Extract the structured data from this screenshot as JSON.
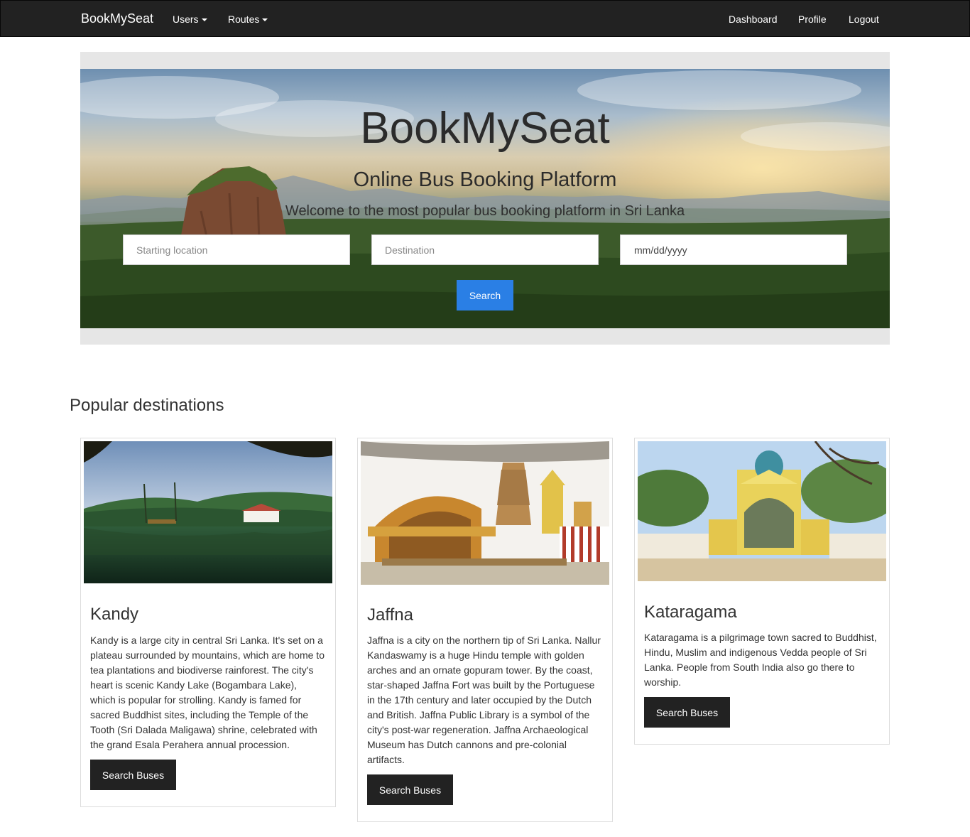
{
  "navbar": {
    "brand": "BookMySeat",
    "left_items": [
      {
        "label": "Users",
        "has_dropdown": true
      },
      {
        "label": "Routes",
        "has_dropdown": true
      }
    ],
    "right_items": [
      {
        "label": "Dashboard"
      },
      {
        "label": "Profile"
      },
      {
        "label": "Logout"
      }
    ]
  },
  "hero": {
    "title": "BookMySeat",
    "subtitle": "Online Bus Booking Platform",
    "lead": "Welcome to the most popular bus booking platform in Sri Lanka",
    "form": {
      "start_placeholder": "Starting location",
      "destination_placeholder": "Destination",
      "date_placeholder": "mm/dd/yyyy",
      "search_label": "Search"
    }
  },
  "section": {
    "title": "Popular destinations"
  },
  "cards": [
    {
      "title": "Kandy",
      "text": "Kandy is a large city in central Sri Lanka. It's set on a plateau surrounded by mountains, which are home to tea plantations and biodiverse rainforest. The city's heart is scenic Kandy Lake (Bogambara Lake), which is popular for strolling. Kandy is famed for sacred Buddhist sites, including the Temple of the Tooth (Sri Dalada Maligawa) shrine, celebrated with the grand Esala Perahera annual procession.",
      "button": "Search Buses"
    },
    {
      "title": "Jaffna",
      "text": "Jaffna is a city on the northern tip of Sri Lanka. Nallur Kandaswamy is a huge Hindu temple with golden arches and an ornate gopuram tower. By the coast, star-shaped Jaffna Fort was built by the Portuguese in the 17th century and later occupied by the Dutch and British. Jaffna Public Library is a symbol of the city's post-war regeneration. Jaffna Archaeological Museum has Dutch cannons and pre-colonial artifacts.",
      "button": "Search Buses"
    },
    {
      "title": "Kataragama",
      "text": "Kataragama is a pilgrimage town sacred to Buddhist, Hindu, Muslim and indigenous Vedda people of Sri Lanka. People from South India also go there to worship.",
      "button": "Search Buses"
    }
  ]
}
